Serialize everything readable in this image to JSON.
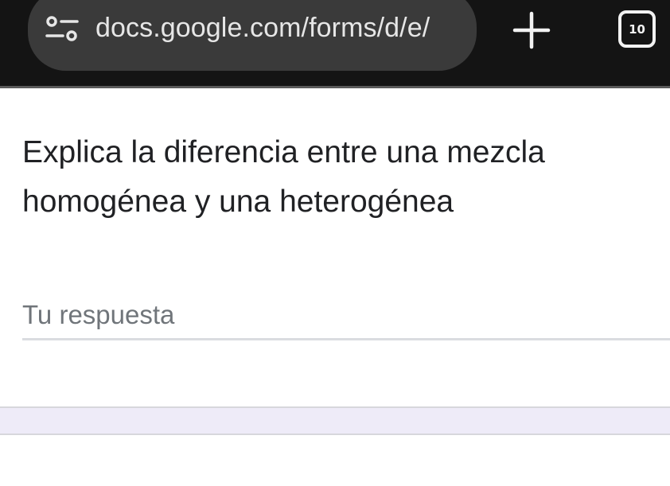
{
  "browser": {
    "url": "docs.google.com/forms/d/e/",
    "tab_count": "10",
    "icons": {
      "site_info": "tune-icon",
      "new_tab": "plus-icon",
      "tabs": "tab-switcher-icon"
    }
  },
  "form": {
    "question": "Explica la diferencia entre una mezcla homogénea y una heterogénea",
    "answer": {
      "placeholder": "Tu respuesta",
      "value": ""
    }
  },
  "colors": {
    "topbar": "#141414",
    "url_pill": "#3a3a3a",
    "section_band": "#eeebf8"
  }
}
